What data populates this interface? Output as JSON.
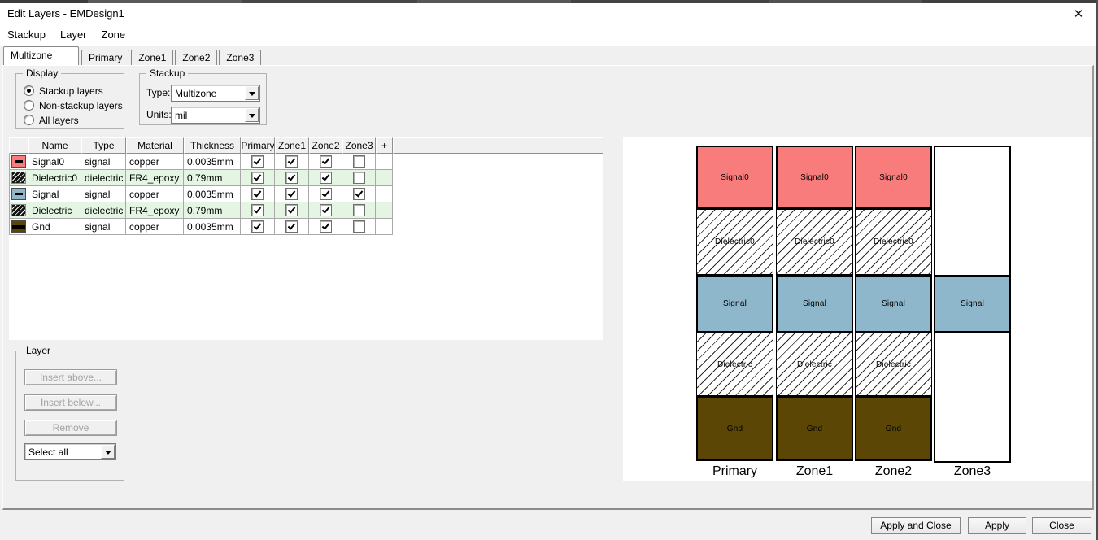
{
  "window": {
    "title": "Edit Layers - EMDesign1",
    "close_glyph": "✕"
  },
  "menu": {
    "items": [
      "Stackup",
      "Layer",
      "Zone"
    ]
  },
  "tabs": {
    "items": [
      {
        "label": "Multizone",
        "selected": true
      },
      {
        "label": "Primary",
        "selected": false
      },
      {
        "label": "Zone1",
        "selected": false
      },
      {
        "label": "Zone2",
        "selected": false
      },
      {
        "label": "Zone3",
        "selected": false
      }
    ]
  },
  "display_group": {
    "title": "Display",
    "options": [
      {
        "label": "Stackup layers",
        "selected": true
      },
      {
        "label": "Non-stackup layers",
        "selected": false
      },
      {
        "label": "All layers",
        "selected": false
      }
    ]
  },
  "stackup_group": {
    "title": "Stackup",
    "type_label": "Type:",
    "type_value": "Multizone",
    "units_label": "Units:",
    "units_value": "mil"
  },
  "layers_table": {
    "headers": [
      "",
      "Name",
      "Type",
      "Material",
      "Thickness",
      "Primary",
      "Zone1",
      "Zone2",
      "Zone3",
      "+"
    ],
    "highlight_color": "#e4f6e3",
    "rows": [
      {
        "name": "Signal0",
        "type": "signal",
        "material": "copper",
        "thickness": "0.0035mm",
        "swatch": {
          "kind": "dash",
          "color": "#f97c7c"
        },
        "checks": [
          true,
          true,
          true,
          false
        ],
        "highlight": false
      },
      {
        "name": "Dielectric0",
        "type": "dielectric",
        "material": "FR4_epoxy",
        "thickness": "0.79mm",
        "swatch": {
          "kind": "hatch",
          "color": "#141414"
        },
        "checks": [
          true,
          true,
          true,
          false
        ],
        "highlight": true
      },
      {
        "name": "Signal",
        "type": "signal",
        "material": "copper",
        "thickness": "0.0035mm",
        "swatch": {
          "kind": "dash",
          "color": "#8fb7cb"
        },
        "checks": [
          true,
          true,
          true,
          true
        ],
        "highlight": false
      },
      {
        "name": "Dielectric",
        "type": "dielectric",
        "material": "FR4_epoxy",
        "thickness": "0.79mm",
        "swatch": {
          "kind": "hatch",
          "color": "#141414"
        },
        "checks": [
          true,
          true,
          true,
          false
        ],
        "highlight": true
      },
      {
        "name": "Gnd",
        "type": "signal",
        "material": "copper",
        "thickness": "0.0035mm",
        "swatch": {
          "kind": "stripe",
          "color": "#5b4606"
        },
        "checks": [
          true,
          true,
          true,
          false
        ],
        "highlight": false
      }
    ]
  },
  "layer_group": {
    "title": "Layer",
    "buttons": [
      {
        "label": "Insert above...",
        "enabled": false
      },
      {
        "label": "Insert below...",
        "enabled": false
      },
      {
        "label": "Remove",
        "enabled": false
      }
    ],
    "select_value": "Select all"
  },
  "stackup_view": {
    "zone_labels": [
      "Primary",
      "Zone1",
      "Zone2",
      "Zone3"
    ],
    "layer_order": [
      "Signal0",
      "Dielectric0",
      "Signal",
      "Dielectric",
      "Gnd"
    ],
    "layer_styles": {
      "Signal0": {
        "kind": "solid",
        "color": "#f97c7c"
      },
      "Dielectric0": {
        "kind": "hatch",
        "color": "#ffffff"
      },
      "Signal": {
        "kind": "solid",
        "color": "#8fb7cb"
      },
      "Dielectric": {
        "kind": "hatch",
        "color": "#ffffff"
      },
      "Gnd": {
        "kind": "solid",
        "color": "#5b4606"
      }
    },
    "columns": [
      {
        "zone": "Primary",
        "layers": [
          "Signal0",
          "Dielectric0",
          "Signal",
          "Dielectric",
          "Gnd"
        ]
      },
      {
        "zone": "Zone1",
        "layers": [
          "Signal0",
          "Dielectric0",
          "Signal",
          "Dielectric",
          "Gnd"
        ]
      },
      {
        "zone": "Zone2",
        "layers": [
          "Signal0",
          "Dielectric0",
          "Signal",
          "Dielectric",
          "Gnd"
        ]
      },
      {
        "zone": "Zone3",
        "layers": [
          "Signal"
        ]
      }
    ]
  },
  "footer": {
    "buttons": [
      "Apply and Close",
      "Apply",
      "Close"
    ]
  }
}
